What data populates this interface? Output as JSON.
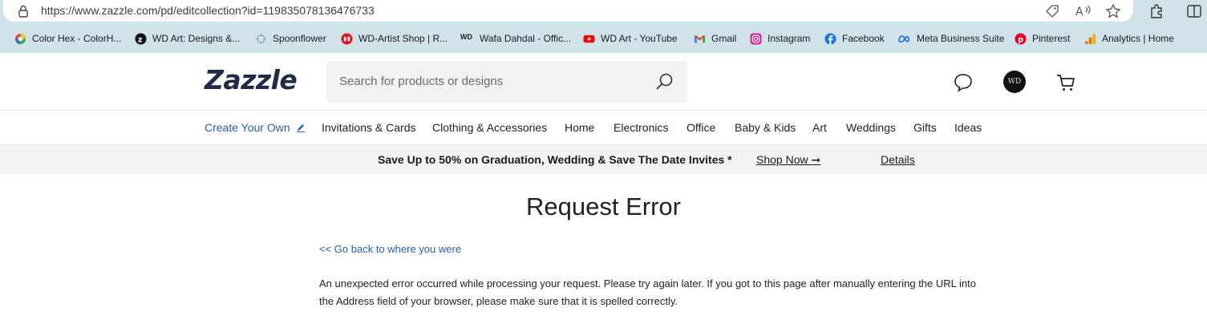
{
  "browser": {
    "url": "https://www.zazzle.com/pd/editcollection?id=119835078136476733",
    "bookmarks": [
      {
        "label": "Color Hex - ColorH...",
        "icon": "color-hex-icon"
      },
      {
        "label": "WD Art: Designs &...",
        "icon": "zazzle-z-icon"
      },
      {
        "label": "Spoonflower",
        "icon": "spoonflower-icon"
      },
      {
        "label": "WD-Artist Shop | R...",
        "icon": "redbubble-icon"
      },
      {
        "label": "Wafa Dahdal - Offic...",
        "icon": "wd-text-icon",
        "icon_text": "WD"
      },
      {
        "label": "WD Art - YouTube",
        "icon": "youtube-icon"
      },
      {
        "label": "Gmail",
        "icon": "gmail-icon"
      },
      {
        "label": "Instagram",
        "icon": "instagram-icon"
      },
      {
        "label": "Facebook",
        "icon": "facebook-icon"
      },
      {
        "label": "Meta Business Suite",
        "icon": "meta-icon"
      },
      {
        "label": "Pinterest",
        "icon": "pinterest-icon"
      },
      {
        "label": "Analytics | Home",
        "icon": "analytics-icon"
      }
    ]
  },
  "header": {
    "logo": "Zazzle",
    "search_placeholder": "Search for products or designs",
    "avatar_text": "WD"
  },
  "nav": {
    "items": [
      "Create Your Own",
      "Invitations & Cards",
      "Clothing & Accessories",
      "Home",
      "Electronics",
      "Office",
      "Baby & Kids",
      "Art",
      "Weddings",
      "Gifts",
      "Ideas"
    ]
  },
  "promo": {
    "text": "Save Up to 50% on Graduation, Wedding & Save The Date Invites *",
    "shop_now": "Shop Now ➞",
    "details": "Details"
  },
  "main": {
    "title": "Request Error",
    "back_link": "<< Go back to where you were",
    "message": "An unexpected error occurred while processing your request. Please try again later. If you got to this page after manually entering the URL into the Address field of your browser, please make sure that it is spelled correctly."
  },
  "colors": {
    "chrome": "#cfe3e9",
    "link": "#2b5ea7",
    "logo": "#212b45",
    "promo_bg": "#f3f3f3"
  }
}
